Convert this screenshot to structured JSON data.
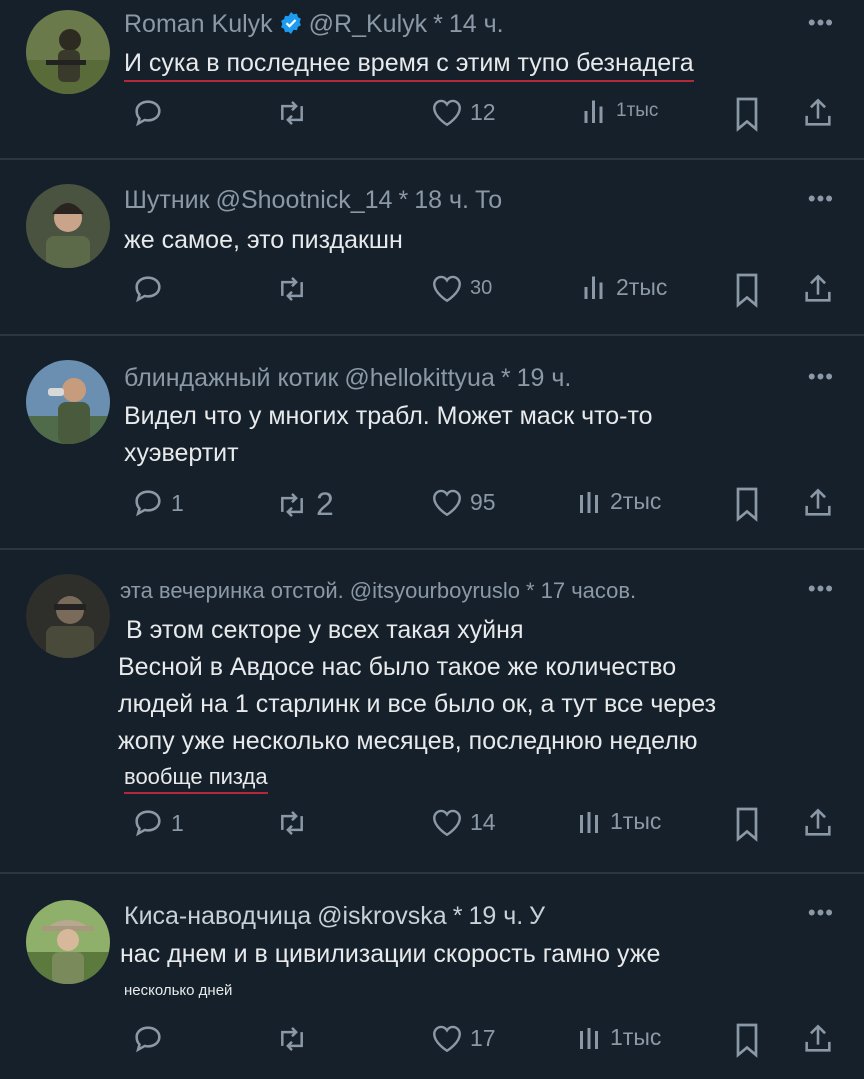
{
  "tweets": [
    {
      "name": "Roman Kulyk",
      "verified": true,
      "handle": "@R_Kulyk",
      "sep": "*",
      "time": "14 ч.",
      "header_tail": "",
      "lines": [
        "И сука в последнее время с этим тупо безнадега"
      ],
      "replies": "",
      "retweets": "",
      "likes": "12",
      "views": "1тыс"
    },
    {
      "name": "Шутник",
      "verified": false,
      "handle": "@Shootnick_14",
      "sep": "*",
      "time": "18 ч.",
      "header_tail": "То",
      "lines": [
        "же самое, это пиздакшн"
      ],
      "replies": "",
      "retweets": "",
      "likes": "30",
      "views": "2тыс"
    },
    {
      "name": "блиндажный котик",
      "verified": false,
      "handle": "@hellokittyua",
      "sep": "*",
      "time": "19 ч.",
      "header_tail": "",
      "lines": [
        "Видел что у многих трабл. Может маск что-то",
        "хуэвертит"
      ],
      "replies": "1",
      "retweets": "2",
      "likes": "95",
      "views": "2тыс"
    },
    {
      "name": "эта вечеринка отстой.",
      "verified": false,
      "handle": "@itsyourboyruslo",
      "sep": "*",
      "time": "17 часов.",
      "header_tail": "",
      "lines": [
        "В этом секторе у всех такая хуйня",
        "Весной в Авдосе нас было такое же количество",
        "людей на 1 старлинк и все было ок, а тут все через",
        "жопу уже несколько месяцев, последнюю неделю",
        "вообще пизда"
      ],
      "replies": "1",
      "retweets": "",
      "likes": "14",
      "views": "1тыс"
    },
    {
      "name": "Киса-наводчица",
      "verified": false,
      "handle": "@iskrovska",
      "sep": "*",
      "time": "19 ч.",
      "header_tail": "У",
      "lines": [
        "нас днем и в цивилизации скорость гамно уже",
        "несколько дней"
      ],
      "replies": "",
      "retweets": "",
      "likes": "17",
      "views": "1тыс"
    }
  ],
  "more_label": "•••",
  "colors": {
    "background": "#15202b",
    "text": "#e7e9ea",
    "muted": "#8b98a5",
    "verified": "#1d9bf0",
    "separator": "#2c3640"
  },
  "icons": [
    "reply-icon",
    "retweet-icon",
    "like-icon",
    "views-icon",
    "bookmark-icon",
    "share-icon",
    "verified-badge-icon",
    "more-icon"
  ]
}
